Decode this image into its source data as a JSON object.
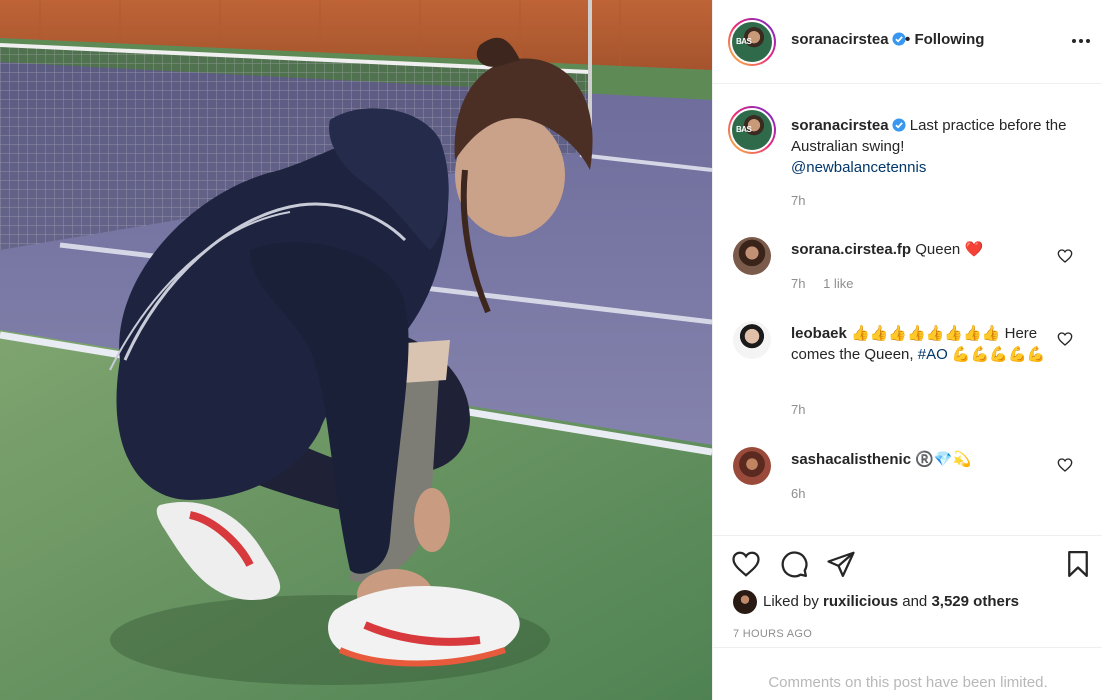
{
  "header": {
    "username": "soranacirstea",
    "separator": "•",
    "follow_status": "Following"
  },
  "caption": {
    "username": "soranacirstea",
    "text": "Last practice before the Australian swing!",
    "mention": "@newbalancetennis",
    "time": "7h"
  },
  "comments": [
    {
      "username": "sorana.cirstea.fp",
      "text": "Queen ❤️",
      "time": "7h",
      "likes": "1 like"
    },
    {
      "username": "leobaek",
      "text": "👍👍👍👍👍👍👍👍 Here comes the Queen, ",
      "hashtag": "#AO",
      "emoji_tail": " 💪💪💪💪💪",
      "time": "7h"
    },
    {
      "username": "sashacalisthenic",
      "text": "®️💎💫",
      "time": "6h"
    }
  ],
  "likes": {
    "prefix": "Liked by",
    "first_user": "ruxilicious",
    "conjunction": "and",
    "others": "3,529 others"
  },
  "posted_time": "7 HOURS AGO",
  "comments_limited": "Comments on this post have been limited.",
  "icons": {
    "more": "more-horizontal-icon",
    "like": "heart-outline-icon",
    "comment": "speech-bubble-icon",
    "share": "paper-plane-icon",
    "save": "bookmark-icon",
    "verified": "verified-badge-icon"
  },
  "colors": {
    "verified": "#3897f0",
    "link": "#00376b",
    "muted": "#8e8e8e",
    "heart": "#ed4956"
  }
}
